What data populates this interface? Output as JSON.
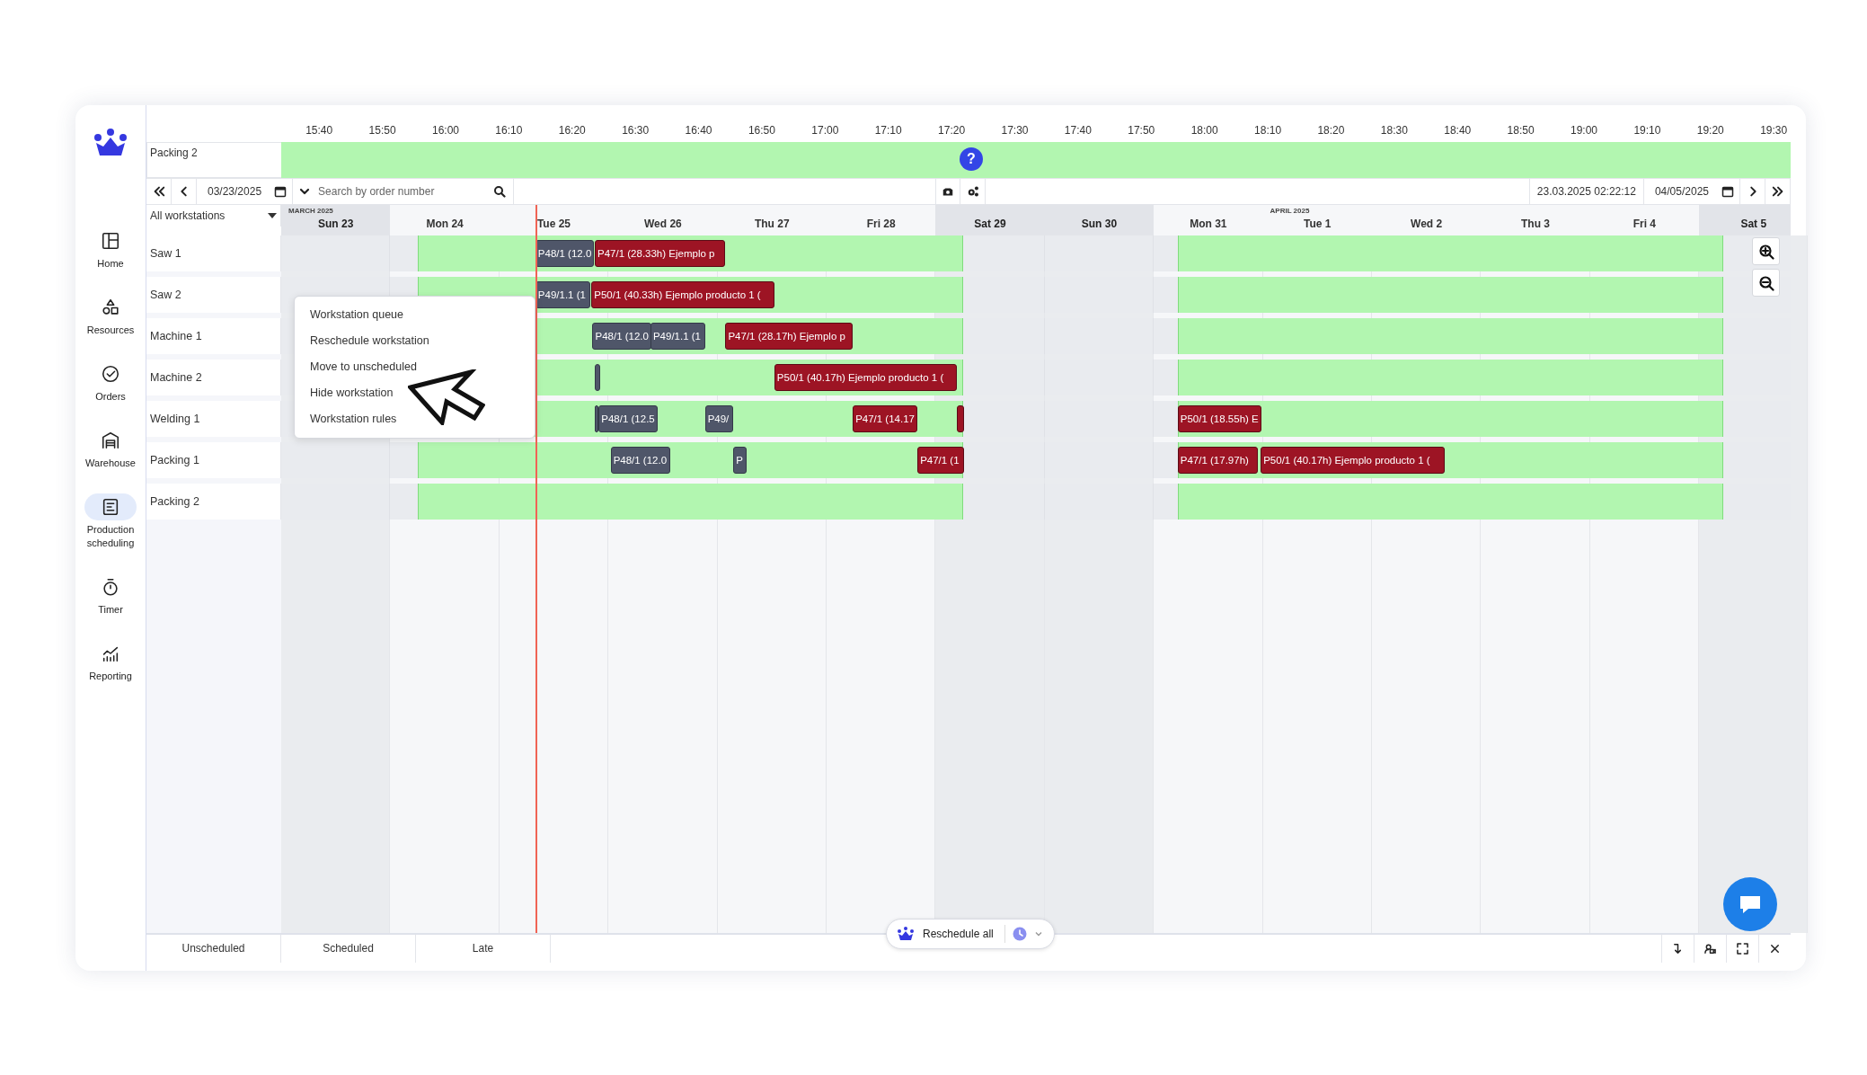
{
  "sidebar": {
    "items": [
      {
        "label": "Home",
        "selected": false
      },
      {
        "label": "Resources",
        "selected": false
      },
      {
        "label": "Orders",
        "selected": false
      },
      {
        "label": "Warehouse",
        "selected": false
      },
      {
        "label": "Production scheduling",
        "selected": true
      },
      {
        "label": "Timer",
        "selected": false
      },
      {
        "label": "Reporting",
        "selected": false
      }
    ]
  },
  "time_axis": [
    "15:40",
    "15:50",
    "16:00",
    "16:10",
    "16:20",
    "16:30",
    "16:40",
    "16:50",
    "17:00",
    "17:10",
    "17:20",
    "17:30",
    "17:40",
    "17:50",
    "18:00",
    "18:10",
    "18:20",
    "18:30",
    "18:40",
    "18:50",
    "19:00",
    "19:10",
    "19:20",
    "19:30"
  ],
  "preview_row": {
    "label": "Packing 2",
    "help_button": "?"
  },
  "toolbar": {
    "start_date": "03/23/2025",
    "search_placeholder": "Search by order number",
    "timestamp": "23.03.2025 02:22:12",
    "end_date": "04/05/2025"
  },
  "filter": {
    "value": "All workstations"
  },
  "days": [
    {
      "label": "Sun 23",
      "weekend": true,
      "month": "MARCH 2025"
    },
    {
      "label": "Mon 24",
      "weekend": false
    },
    {
      "label": "Tue 25",
      "weekend": false
    },
    {
      "label": "Wed 26",
      "weekend": false
    },
    {
      "label": "Thu 27",
      "weekend": false
    },
    {
      "label": "Fri 28",
      "weekend": false
    },
    {
      "label": "Sat 29",
      "weekend": true
    },
    {
      "label": "Sun 30",
      "weekend": true
    },
    {
      "label": "Mon 31",
      "weekend": false
    },
    {
      "label": "Tue 1",
      "weekend": false,
      "month": "APRIL 2025"
    },
    {
      "label": "Wed 2",
      "weekend": false
    },
    {
      "label": "Thu 3",
      "weekend": false
    },
    {
      "label": "Fri 4",
      "weekend": false
    },
    {
      "label": "Sat 5",
      "weekend": true
    }
  ],
  "workstations": [
    {
      "name": "Saw 1",
      "tasks": [
        {
          "label": "P48/1 (12.0",
          "kind": "queued"
        },
        {
          "label": "P47/1 (28.33h) Ejemplo p",
          "kind": "late"
        }
      ]
    },
    {
      "name": "Saw 2",
      "tasks": [
        {
          "label": "P49/1.1 (1",
          "kind": "queued"
        },
        {
          "label": "P50/1 (40.33h) Ejemplo producto 1 (",
          "kind": "late"
        }
      ]
    },
    {
      "name": "Machine 1",
      "tasks": [
        {
          "label": "P48/1 (12.0",
          "kind": "queued"
        },
        {
          "label": "P49/1.1 (1",
          "kind": "queued"
        },
        {
          "label": "P47/1 (28.17h) Ejemplo p",
          "kind": "late"
        }
      ]
    },
    {
      "name": "Machine 2",
      "tasks": [
        {
          "kind": "queued"
        },
        {
          "label": "P50/1 (40.17h) Ejemplo producto 1 (",
          "kind": "late"
        }
      ]
    },
    {
      "name": "Welding 1",
      "tasks": [
        {
          "kind": "queued"
        },
        {
          "label": "P48/1 (12.5",
          "kind": "queued"
        },
        {
          "label": "P49/",
          "kind": "queued"
        },
        {
          "label": "P47/1 (14.17",
          "kind": "late"
        },
        {
          "kind": "late"
        },
        {
          "label": "P50/1 (18.55h) E",
          "kind": "late"
        }
      ]
    },
    {
      "name": "Packing 1",
      "tasks": [
        {
          "label": "P48/1 (12.0",
          "kind": "queued"
        },
        {
          "label": "P",
          "kind": "queued"
        },
        {
          "label": "P47/1 (1",
          "kind": "late"
        },
        {
          "label": "P47/1 (17.97h)",
          "kind": "late"
        },
        {
          "label": "P50/1 (40.17h) Ejemplo producto 1 (",
          "kind": "late"
        }
      ]
    },
    {
      "name": "Packing 2"
    }
  ],
  "context_menu": {
    "items": [
      "Workstation queue",
      "Reschedule workstation",
      "Move to unscheduled",
      "Hide workstation",
      "Workstation rules"
    ]
  },
  "bottom_tabs": [
    "Unscheduled",
    "Scheduled",
    "Late"
  ],
  "reschedule": {
    "label": "Reschedule all"
  }
}
